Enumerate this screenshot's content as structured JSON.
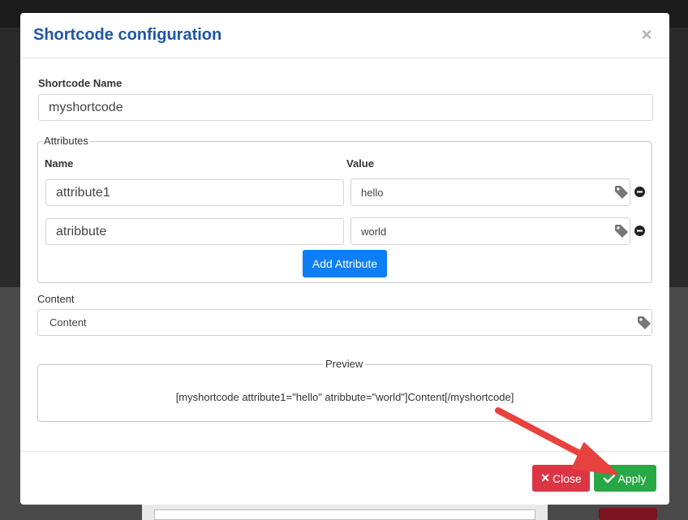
{
  "dialog": {
    "title": "Shortcode configuration",
    "close_symbol": "×"
  },
  "shortcode_name": {
    "label": "Shortcode Name",
    "value": "myshortcode"
  },
  "attributes": {
    "legend": "Attributes",
    "name_header": "Name",
    "value_header": "Value",
    "rows": [
      {
        "name": "attribute1",
        "value": "hello"
      },
      {
        "name": "atribbute",
        "value": "world"
      }
    ],
    "add_label": "Add Attribute"
  },
  "content": {
    "label": "Content",
    "value": "Content"
  },
  "preview": {
    "legend": "Preview",
    "text": "[myshortcode attribute1=\"hello\" atribbute=\"world\"]Content[/myshortcode]"
  },
  "footer": {
    "close_label": "Close",
    "apply_label": "Apply"
  },
  "colors": {
    "title": "#1e56a6",
    "primary": "#0d7ef5",
    "danger": "#dc3545",
    "success": "#28a745",
    "arrow": "#e8413e"
  }
}
